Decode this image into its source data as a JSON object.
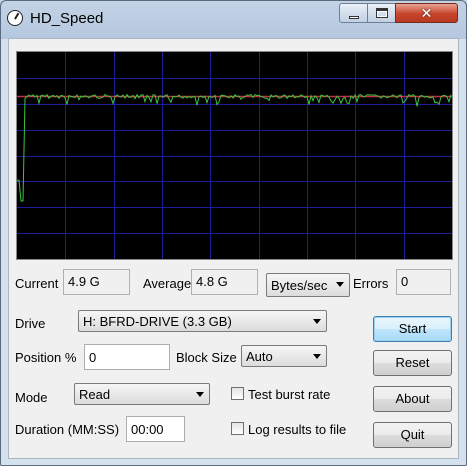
{
  "window": {
    "title": "HD_Speed",
    "close_glyph": "✕"
  },
  "graph": {
    "background": "#000000",
    "grid_color": "#1d1d9c",
    "average_line_color": "#c0304a",
    "trace_color": "#3ec43e",
    "average_level": 0.785
  },
  "stats": {
    "current_label": "Current",
    "current_value": "4.9 G",
    "average_label": "Average",
    "average_value": "4.8 G",
    "unit_selected": "Bytes/sec",
    "errors_label": "Errors",
    "errors_value": "0"
  },
  "form": {
    "drive_label": "Drive",
    "drive_selected": "H: BFRD-DRIVE (3.3 GB)",
    "position_label": "Position %",
    "position_value": "0",
    "block_size_label": "Block Size",
    "block_size_selected": "Auto",
    "mode_label": "Mode",
    "mode_selected": "Read",
    "test_burst_label": "Test burst rate",
    "duration_label": "Duration (MM:SS)",
    "duration_value": "00:00",
    "log_label": "Log results to file"
  },
  "buttons": {
    "start": "Start",
    "reset": "Reset",
    "about": "About",
    "quit": "Quit"
  }
}
